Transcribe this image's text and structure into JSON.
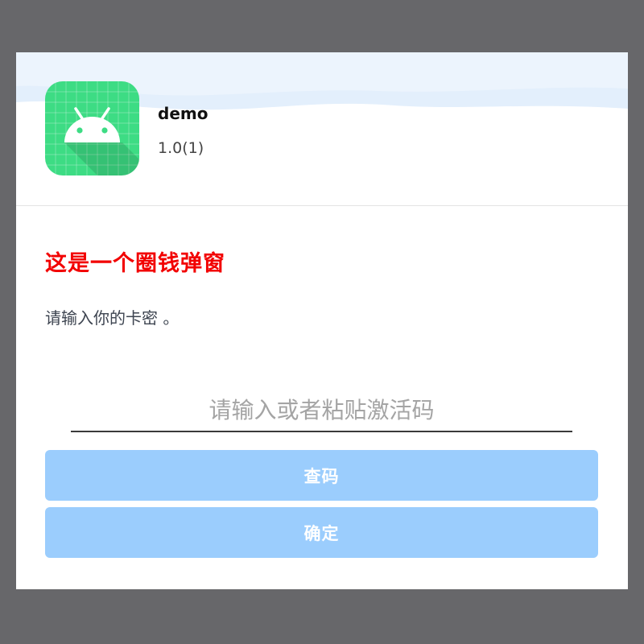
{
  "app": {
    "name": "demo",
    "version": "1.0(1)",
    "icon": "android-icon",
    "icon_bg_color": "#3ddc84"
  },
  "dialog": {
    "title": "这是一个圈钱弹窗",
    "title_color": "#f20000",
    "message": "请输入你的卡密 。"
  },
  "input": {
    "placeholder": "请输入或者粘贴激活码",
    "value": ""
  },
  "buttons": {
    "query_label": "查码",
    "confirm_label": "确定",
    "color": "#9bcdfd"
  }
}
